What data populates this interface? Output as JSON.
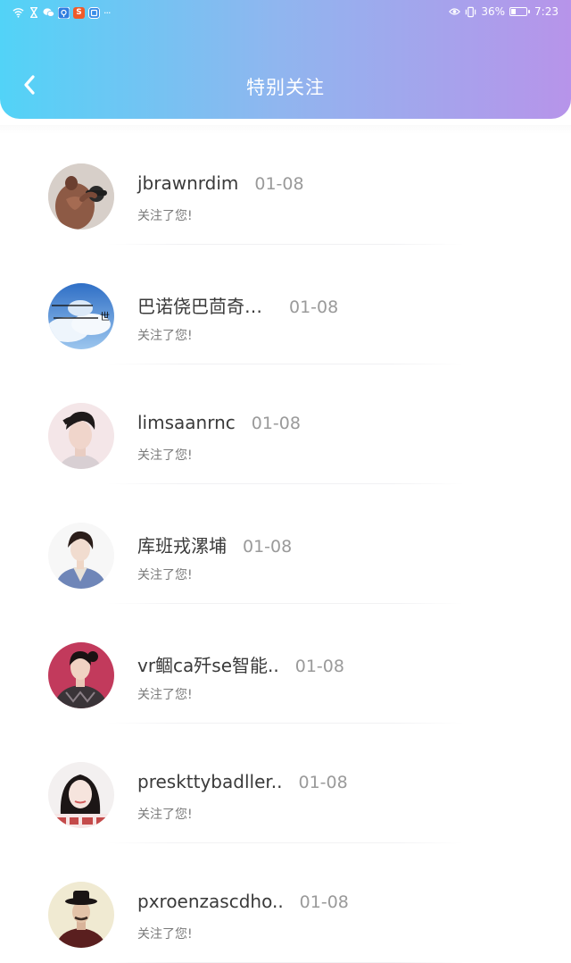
{
  "status_bar": {
    "battery_percent": "36%",
    "time": "7:23",
    "battery_level": 0.36,
    "icons_left": [
      "wifi-icon",
      "hourglass-icon",
      "wechat-icon",
      "blue-app-icon",
      "sogou-icon",
      "tool-app-icon",
      "more-dots-icon"
    ],
    "icons_right": [
      "eye-icon",
      "vibrate-icon",
      "battery-icon"
    ],
    "more": "···",
    "app_badge_s": "S"
  },
  "header": {
    "title": "特别关注",
    "back_icon": "chevron-left-icon",
    "gradient_colors": [
      "#52d3f7",
      "#b794ea"
    ]
  },
  "follow_list": [
    {
      "name": "jbrawnrdim",
      "date": "01-08",
      "subtitle": "关注了您!"
    },
    {
      "name": "巴诺侥巴茴奇…",
      "date": "01-08",
      "subtitle": "关注了您!"
    },
    {
      "name": "limsaanrnc",
      "date": "01-08",
      "subtitle": "关注了您!"
    },
    {
      "name": "库班戎漯埔",
      "date": "01-08",
      "subtitle": "关注了您!"
    },
    {
      "name": "vr鲴ca歼se智能..",
      "date": "01-08",
      "subtitle": "关注了您!"
    },
    {
      "name": "preskttybadller..",
      "date": "01-08",
      "subtitle": "关注了您!"
    },
    {
      "name": "pxroenzascdho..",
      "date": "01-08",
      "subtitle": "关注了您!"
    }
  ]
}
